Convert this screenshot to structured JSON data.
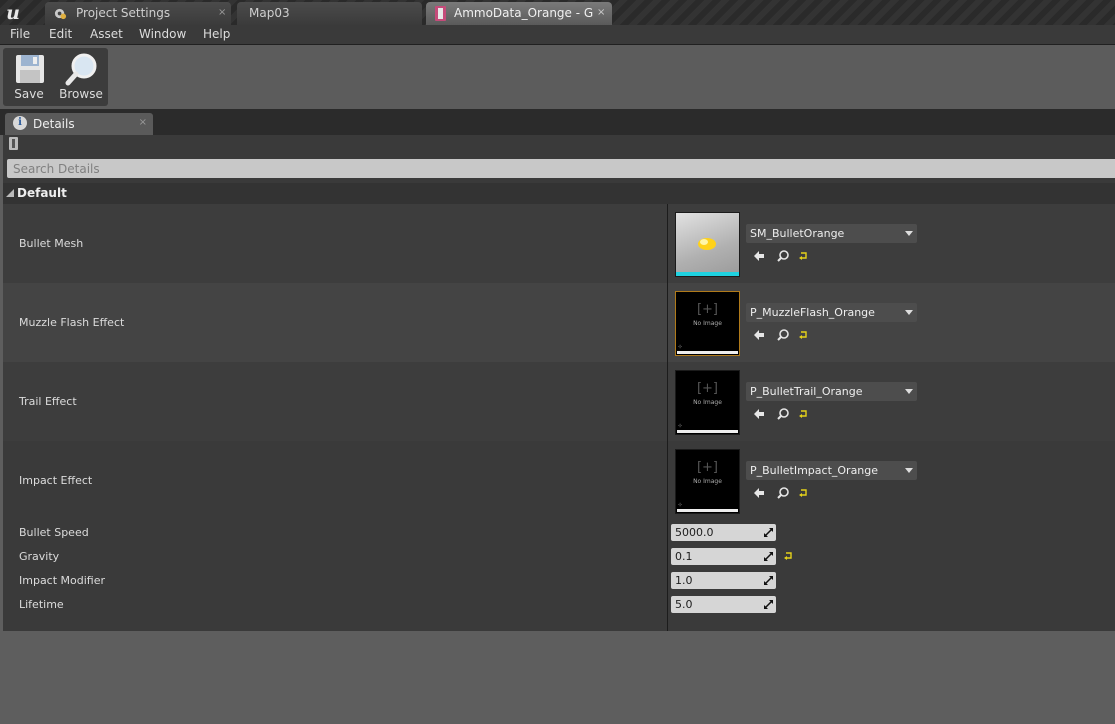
{
  "tabs": [
    {
      "label": "Project Settings",
      "close": "×",
      "icon": "gear-icon"
    },
    {
      "label": "Map03"
    },
    {
      "label": "AmmoData_Orange - Gen",
      "close": "×",
      "icon": "data-asset-icon"
    }
  ],
  "menu": [
    "File",
    "Edit",
    "Asset",
    "Window",
    "Help"
  ],
  "toolbar": {
    "save": "Save",
    "browse": "Browse"
  },
  "details_tab": {
    "label": "Details",
    "close": "×"
  },
  "search": {
    "placeholder": "Search Details"
  },
  "category": "Default",
  "asset_rows": [
    {
      "name": "Bullet Mesh",
      "value": "SM_BulletOrange",
      "thumb": "mesh"
    },
    {
      "name": "Muzzle Flash Effect",
      "value": "P_MuzzleFlash_Orange",
      "thumb": "none"
    },
    {
      "name": "Trail Effect",
      "value": "P_BulletTrail_Orange",
      "thumb": "none"
    },
    {
      "name": "Impact Effect",
      "value": "P_BulletImpact_Orange",
      "thumb": "none"
    }
  ],
  "no_image": "No Image",
  "thumb_plus": "[+]",
  "number_rows": [
    {
      "name": "Bullet Speed",
      "value": "5000.0"
    },
    {
      "name": "Gravity",
      "value": "0.1"
    },
    {
      "name": "Impact Modifier",
      "value": "1.0"
    },
    {
      "name": "Lifetime",
      "value": "5.0"
    }
  ],
  "colors": {
    "accent_yellow": "#e5d21a",
    "selection_orange": "#b07a1a",
    "mesh_cyan": "#1fd2e0"
  }
}
